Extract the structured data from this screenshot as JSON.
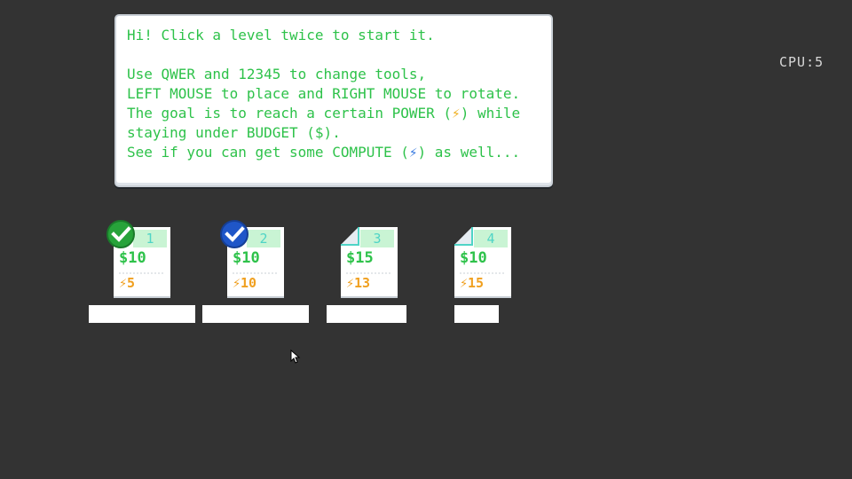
{
  "intro": {
    "line1": "Hi! Click a level twice to start it.",
    "line2": "Use QWER and 12345 to change tools,",
    "line3": "LEFT MOUSE to place and RIGHT MOUSE to rotate.",
    "line4a": "The goal is to reach a certain POWER (",
    "line4b": ") while",
    "line5": "staying under BUDGET ($).",
    "line6a": "See if you can get some COMPUTE (",
    "line6b": ") as well...",
    "power_symbol": "⚡",
    "compute_symbol": "⚡"
  },
  "cpu_label": "CPU:5",
  "levels": [
    {
      "number": "1",
      "cost": "$10",
      "power": "5",
      "completed": true,
      "badge_color": "#27a33a"
    },
    {
      "number": "2",
      "cost": "$10",
      "power": "10",
      "completed": true,
      "badge_color": "#1f56c8"
    },
    {
      "number": "3",
      "cost": "$15",
      "power": "13",
      "completed": false
    },
    {
      "number": "4",
      "cost": "$10",
      "power": "15",
      "completed": false
    }
  ],
  "colors": {
    "background": "#333333",
    "text_green": "#2ec24a",
    "power_orange": "#f0a020",
    "compute_blue": "#3a7be0",
    "level_number": "#4fd4c6"
  }
}
